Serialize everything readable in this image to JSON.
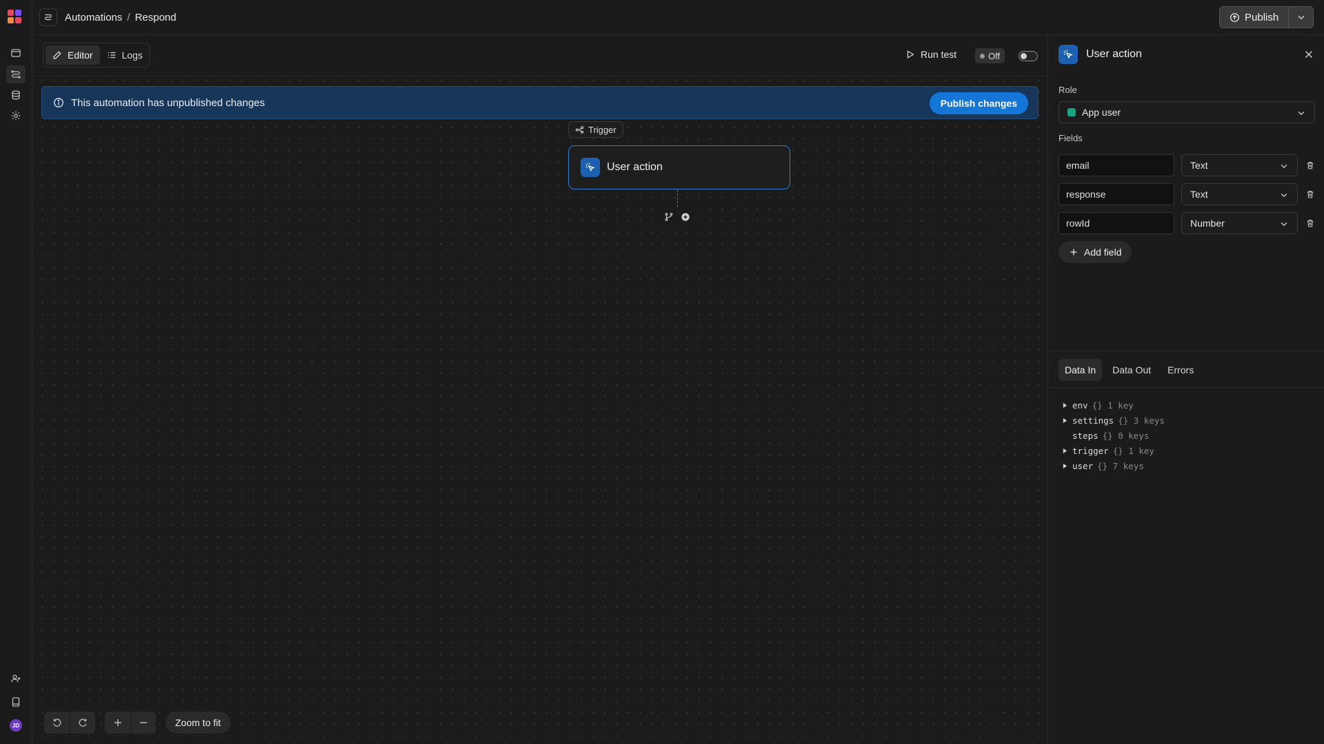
{
  "breadcrumb": {
    "section": "Automations",
    "separator": "/",
    "page": "Respond"
  },
  "publish": {
    "label": "Publish"
  },
  "tabs": [
    {
      "label": "Editor"
    },
    {
      "label": "Logs"
    }
  ],
  "run_test": {
    "label": "Run test"
  },
  "status": {
    "label": "Off"
  },
  "banner": {
    "message": "This automation has unpublished changes",
    "button": "Publish changes"
  },
  "trigger": {
    "label": "Trigger",
    "node_title": "User action"
  },
  "canvas_controls": {
    "zoom_fit": "Zoom to fit"
  },
  "panel": {
    "title": "User action",
    "role_label": "Role",
    "role_value": "App user",
    "fields_label": "Fields",
    "fields": [
      {
        "name": "email",
        "type": "Text"
      },
      {
        "name": "response",
        "type": "Text"
      },
      {
        "name": "rowId",
        "type": "Number"
      }
    ],
    "add_field": "Add field",
    "data_tabs": [
      {
        "label": "Data In"
      },
      {
        "label": "Data Out"
      },
      {
        "label": "Errors"
      }
    ],
    "tree": [
      {
        "key": "env",
        "meta": "{} 1 key",
        "expandable": true
      },
      {
        "key": "settings",
        "meta": "{} 3 keys",
        "expandable": true
      },
      {
        "key": "steps",
        "meta": "{} 0 keys",
        "expandable": false
      },
      {
        "key": "trigger",
        "meta": "{} 1 key",
        "expandable": true
      },
      {
        "key": "user",
        "meta": "{} 7 keys",
        "expandable": true
      }
    ]
  },
  "user": {
    "initials": "JD"
  },
  "colors": {
    "accent": "#1476d6",
    "banner_bg": "#17365a",
    "role_dot": "#18a383",
    "node_border": "#2f7ed6"
  }
}
